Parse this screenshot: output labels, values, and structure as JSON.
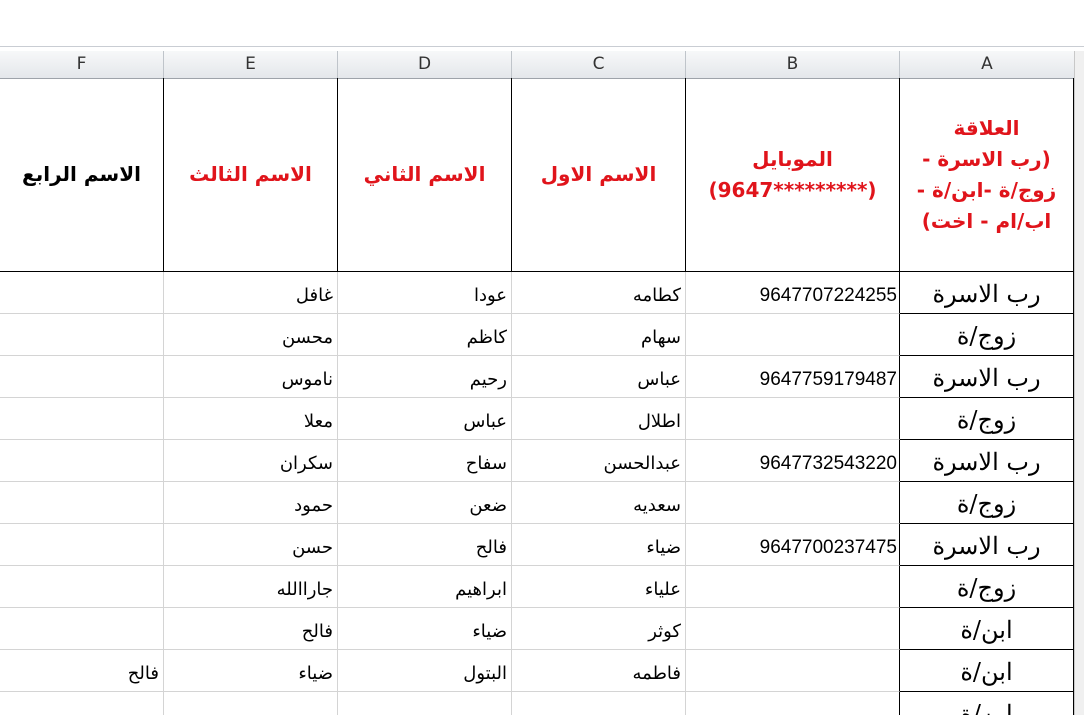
{
  "columns": [
    "A",
    "B",
    "C",
    "D",
    "E",
    "F"
  ],
  "headers": {
    "A_lines": [
      "العلاقة",
      "(رب الاسرة -",
      "زوج/ة -ابن/ة -",
      "اب/ام - اخت)"
    ],
    "B_lines": [
      "الموبايل",
      "(9647*********)"
    ],
    "C": "الاسم الاول",
    "D": "الاسم الثاني",
    "E": "الاسم الثالث",
    "F": "الاسم الرابع"
  },
  "rows": [
    {
      "relation": "رب الاسرة",
      "mobile": "9647707224255",
      "first": "كطامه",
      "second": "عودا",
      "third": "غافل",
      "fourth": ""
    },
    {
      "relation": "زوج/ة",
      "mobile": "",
      "first": "سهام",
      "second": "كاظم",
      "third": "محسن",
      "fourth": ""
    },
    {
      "relation": "رب الاسرة",
      "mobile": "9647759179487",
      "first": "عباس",
      "second": "رحيم",
      "third": "ناموس",
      "fourth": ""
    },
    {
      "relation": "زوج/ة",
      "mobile": "",
      "first": "اطلال",
      "second": "عباس",
      "third": "معلا",
      "fourth": ""
    },
    {
      "relation": "رب الاسرة",
      "mobile": "9647732543220",
      "first": "عبدالحسن",
      "second": "سفاح",
      "third": "سكران",
      "fourth": ""
    },
    {
      "relation": "زوج/ة",
      "mobile": "",
      "first": "سعديه",
      "second": "ضعن",
      "third": "حمود",
      "fourth": ""
    },
    {
      "relation": "رب الاسرة",
      "mobile": "9647700237475",
      "first": "ضياء",
      "second": "فالح",
      "third": "حسن",
      "fourth": ""
    },
    {
      "relation": "زوج/ة",
      "mobile": "",
      "first": "علياء",
      "second": "ابراهيم",
      "third": "جاراالله",
      "fourth": ""
    },
    {
      "relation": "ابن/ة",
      "mobile": "",
      "first": "كوثر",
      "second": "ضياء",
      "third": "فالح",
      "fourth": ""
    },
    {
      "relation": "ابن/ة",
      "mobile": "",
      "first": "فاطمه",
      "second": "البتول",
      "third": "ضياء",
      "fourth": "فالح"
    },
    {
      "relation": "ابن/ة",
      "mobile": "",
      "first": "",
      "second": "",
      "third": "",
      "fourth": ""
    }
  ]
}
